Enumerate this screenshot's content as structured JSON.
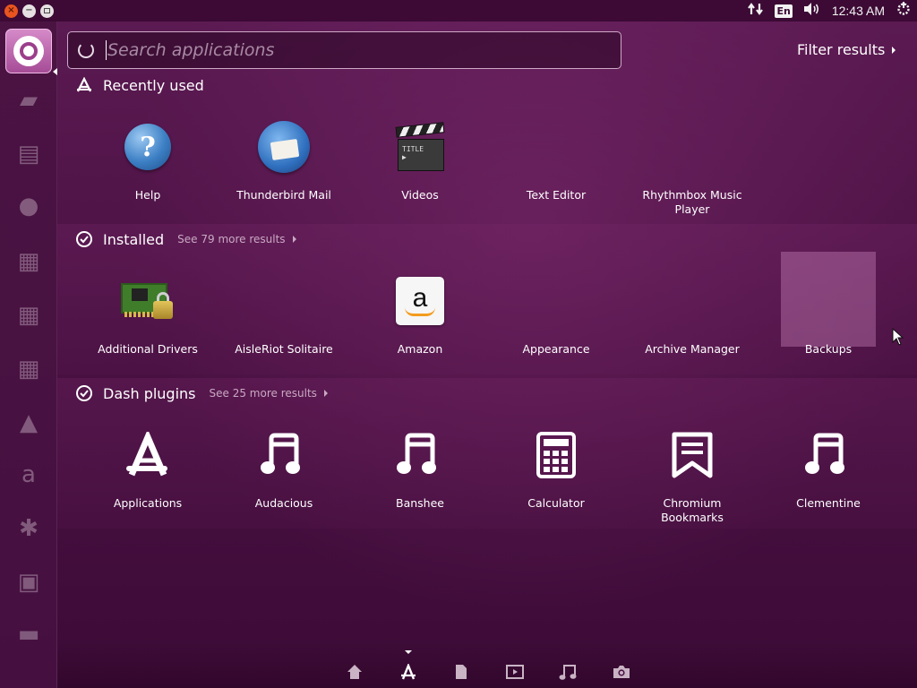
{
  "window_controls": {
    "close": "×",
    "minimize": "−"
  },
  "top_panel": {
    "keyboard_layout": "En",
    "clock": "12:43 AM"
  },
  "search": {
    "placeholder": "Search applications",
    "value": ""
  },
  "filter_results": {
    "label": "Filter results"
  },
  "categories": [
    {
      "title": "Recently used",
      "more": "",
      "items": [
        {
          "label": "Help",
          "icon": "help-icon"
        },
        {
          "label": "Thunderbird Mail",
          "icon": "thunderbird-icon"
        },
        {
          "label": "Videos",
          "icon": "videos-clapperboard-icon"
        },
        {
          "label": "Text Editor",
          "icon": "text-editor-icon"
        },
        {
          "label": "Rhythmbox Music Player",
          "icon": "rhythmbox-icon"
        }
      ]
    },
    {
      "title": "Installed",
      "more": "See 79 more results",
      "items": [
        {
          "label": "Additional Drivers",
          "icon": "additional-drivers-icon"
        },
        {
          "label": "AisleRiot Solitaire",
          "icon": "solitaire-icon"
        },
        {
          "label": "Amazon",
          "icon": "amazon-icon"
        },
        {
          "label": "Appearance",
          "icon": "appearance-icon"
        },
        {
          "label": "Archive Manager",
          "icon": "archive-manager-icon"
        },
        {
          "label": "Backups",
          "icon": "backups-icon"
        }
      ]
    },
    {
      "title": "Dash plugins",
      "more": "See 25 more results",
      "items": [
        {
          "label": "Applications",
          "icon": "applications-lens-icon"
        },
        {
          "label": "Audacious",
          "icon": "music-note-icon"
        },
        {
          "label": "Banshee",
          "icon": "music-note-icon"
        },
        {
          "label": "Calculator",
          "icon": "calculator-icon"
        },
        {
          "label": "Chromium Bookmarks",
          "icon": "bookmark-icon"
        },
        {
          "label": "Clementine",
          "icon": "music-note-icon"
        }
      ]
    }
  ],
  "lenses": [
    {
      "name": "home-lens",
      "icon": "home-icon"
    },
    {
      "name": "applications-lens",
      "icon": "applications-icon",
      "active": true
    },
    {
      "name": "files-lens",
      "icon": "file-icon"
    },
    {
      "name": "video-lens",
      "icon": "video-icon"
    },
    {
      "name": "music-lens",
      "icon": "music-icon"
    },
    {
      "name": "photos-lens",
      "icon": "camera-icon"
    }
  ],
  "colors": {
    "panel": "#3c0a35",
    "dash_top": "#5b1a52",
    "dash_bottom": "#3d0b37",
    "close_button": "#e9541f",
    "launcher_dash_button": "#b65aa5"
  }
}
